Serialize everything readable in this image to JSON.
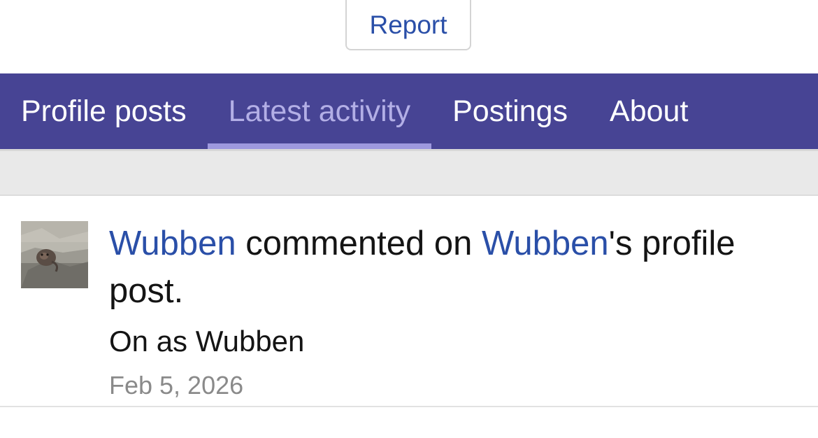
{
  "header": {
    "report_label": "Report"
  },
  "tabs": [
    {
      "label": "Profile posts",
      "active": false
    },
    {
      "label": "Latest activity",
      "active": true
    },
    {
      "label": "Postings",
      "active": false
    },
    {
      "label": "About",
      "active": false
    }
  ],
  "activity": {
    "actor": "Wubben",
    "verb": "commented on",
    "target_user": "Wubben",
    "target_suffix": "'s profile post.",
    "snippet": "On as Wubben",
    "date": "Feb 5, 2026"
  },
  "colors": {
    "tab_bar": "#474494",
    "link": "#2a4fa8",
    "active_tab_text": "#b3afe6"
  }
}
